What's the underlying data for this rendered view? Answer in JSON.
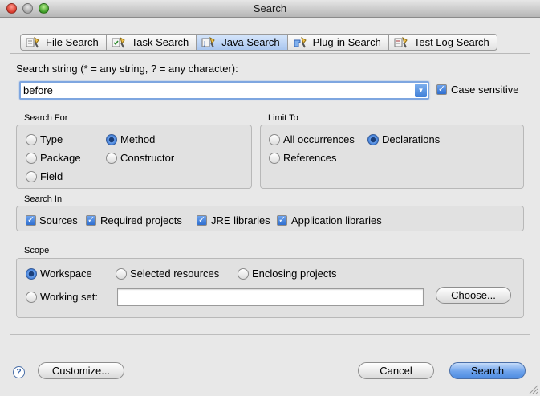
{
  "window": {
    "title": "Search"
  },
  "tabs": [
    {
      "label": "File Search"
    },
    {
      "label": "Task Search"
    },
    {
      "label": "Java Search",
      "active": true
    },
    {
      "label": "Plug-in Search"
    },
    {
      "label": "Test Log Search"
    }
  ],
  "search_string": {
    "label": "Search string (* = any string, ? = any character):",
    "value": "before",
    "case_sensitive_label": "Case sensitive",
    "case_sensitive": true
  },
  "search_for": {
    "title": "Search For",
    "options": [
      {
        "label": "Type",
        "selected": false
      },
      {
        "label": "Method",
        "selected": true
      },
      {
        "label": "Package",
        "selected": false
      },
      {
        "label": "Constructor",
        "selected": false
      },
      {
        "label": "Field",
        "selected": false
      }
    ]
  },
  "limit_to": {
    "title": "Limit To",
    "options": [
      {
        "label": "All occurrences",
        "selected": false
      },
      {
        "label": "Declarations",
        "selected": true
      },
      {
        "label": "References",
        "selected": false
      }
    ]
  },
  "search_in": {
    "title": "Search In",
    "options": [
      {
        "label": "Sources",
        "checked": true
      },
      {
        "label": "Required projects",
        "checked": true
      },
      {
        "label": "JRE libraries",
        "checked": true
      },
      {
        "label": "Application libraries",
        "checked": true
      }
    ]
  },
  "scope": {
    "title": "Scope",
    "options": [
      {
        "label": "Workspace",
        "selected": true
      },
      {
        "label": "Selected resources",
        "selected": false
      },
      {
        "label": "Enclosing projects",
        "selected": false
      },
      {
        "label": "Working set:",
        "selected": false
      }
    ],
    "working_set_value": "",
    "choose_label": "Choose..."
  },
  "footer": {
    "help_icon": "question-mark",
    "customize_label": "Customize...",
    "cancel_label": "Cancel",
    "search_label": "Search"
  },
  "colors": {
    "accent": "#4d8be0",
    "window_bg": "#e8e8e8",
    "close": "#d93a2c",
    "zoom": "#3a9a24"
  }
}
